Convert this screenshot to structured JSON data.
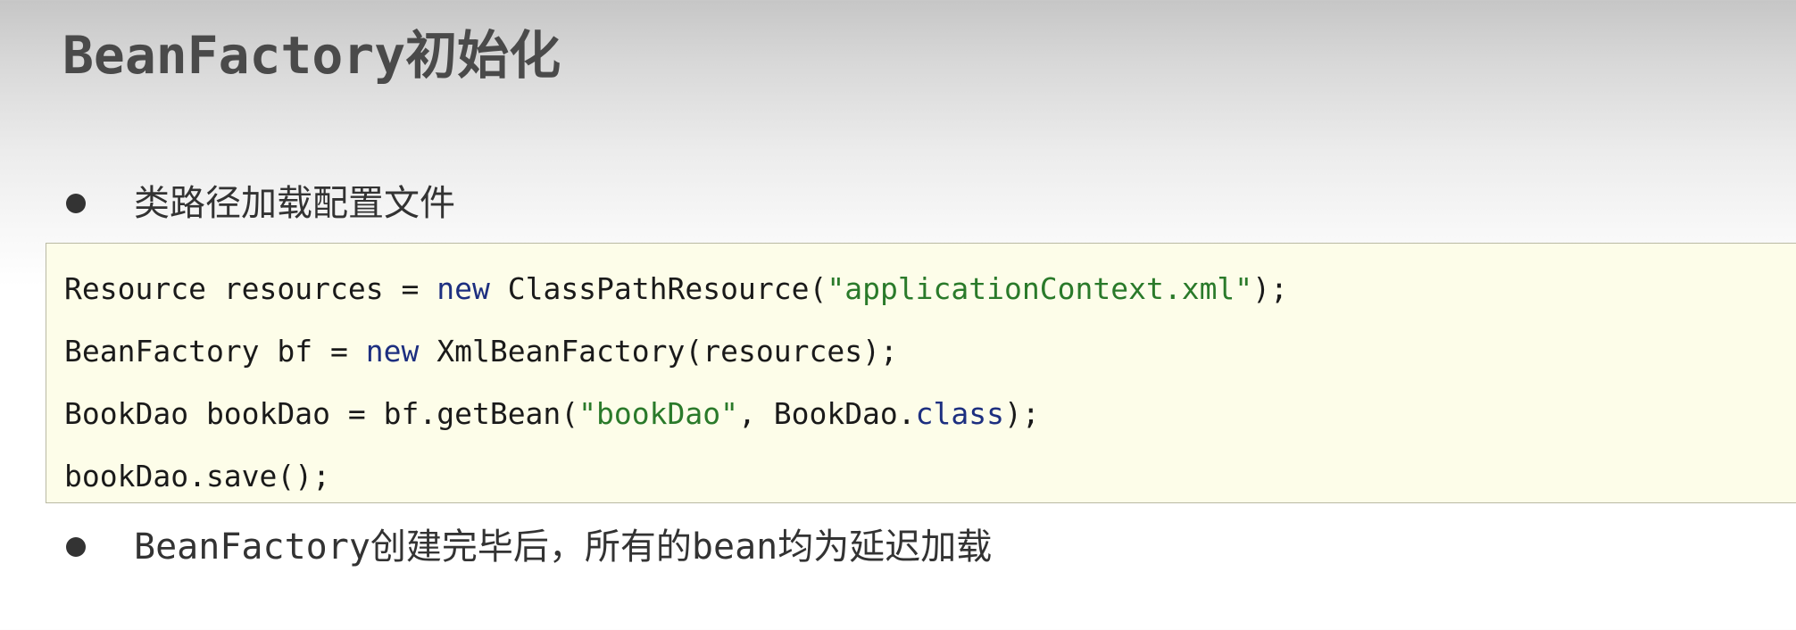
{
  "slide": {
    "title": "BeanFactory初始化"
  },
  "bullets": [
    {
      "text": "类路径加载配置文件"
    },
    {
      "text": "BeanFactory创建完毕后，所有的bean均为延迟加载"
    }
  ],
  "code": {
    "lines": [
      {
        "tokens": [
          "Resource resources = ",
          "new",
          " ClassPathResource(",
          "\"applicationContext.xml\"",
          ");"
        ]
      },
      {
        "tokens": [
          "BeanFactory bf = ",
          "new",
          " XmlBeanFactory(resources);"
        ]
      },
      {
        "tokens": [
          "BookDao bookDao = bf.getBean(",
          "\"bookDao\"",
          ", BookDao.",
          "class",
          ");"
        ]
      },
      {
        "tokens": [
          "bookDao.save();"
        ]
      }
    ]
  },
  "colors": {
    "keyword": "#1d2f80",
    "string": "#2a7a2a",
    "code_background": "#fdfde9"
  }
}
